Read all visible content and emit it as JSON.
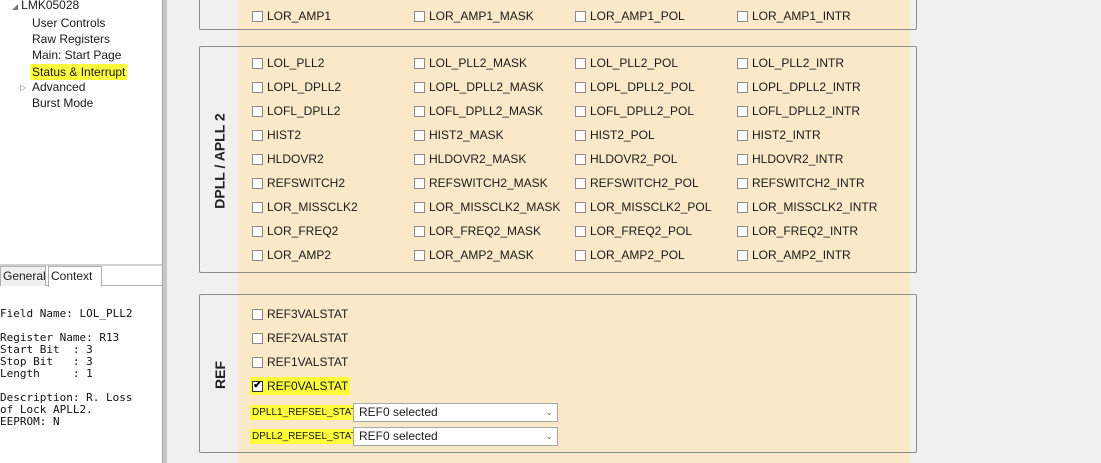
{
  "tree": {
    "root": "LMK05028",
    "items": [
      "User Controls",
      "Raw Registers",
      "Main: Start Page",
      "Status & Interrupt",
      "Advanced",
      "Burst Mode"
    ]
  },
  "tabs": [
    "General",
    "Context"
  ],
  "context_lines": [
    "Field Name: LOL_PLL2",
    "",
    "Register Name: R13",
    "Start Bit  : 3",
    "Stop Bit   : 3",
    "Length     : 1",
    "",
    "Description: R. Loss",
    "of Lock APLL2.",
    "EEPROM: N"
  ],
  "top_row": [
    "LOR_AMP1",
    "LOR_AMP1_MASK",
    "LOR_AMP1_POL",
    "LOR_AMP1_INTR"
  ],
  "dpll2": {
    "label": "DPLL / APLL 2",
    "rows": [
      [
        "LOL_PLL2",
        "LOL_PLL2_MASK",
        "LOL_PLL2_POL",
        "LOL_PLL2_INTR"
      ],
      [
        "LOPL_DPLL2",
        "LOPL_DPLL2_MASK",
        "LOPL_DPLL2_POL",
        "LOPL_DPLL2_INTR"
      ],
      [
        "LOFL_DPLL2",
        "LOFL_DPLL2_MASK",
        "LOFL_DPLL2_POL",
        "LOFL_DPLL2_INTR"
      ],
      [
        "HIST2",
        "HIST2_MASK",
        "HIST2_POL",
        "HIST2_INTR"
      ],
      [
        "HLDOVR2",
        "HLDOVR2_MASK",
        "HLDOVR2_POL",
        "HLDOVR2_INTR"
      ],
      [
        "REFSWITCH2",
        "REFSWITCH2_MASK",
        "REFSWITCH2_POL",
        "REFSWITCH2_INTR"
      ],
      [
        "LOR_MISSCLK2",
        "LOR_MISSCLK2_MASK",
        "LOR_MISSCLK2_POL",
        "LOR_MISSCLK2_INTR"
      ],
      [
        "LOR_FREQ2",
        "LOR_FREQ2_MASK",
        "LOR_FREQ2_POL",
        "LOR_FREQ2_INTR"
      ],
      [
        "LOR_AMP2",
        "LOR_AMP2_MASK",
        "LOR_AMP2_POL",
        "LOR_AMP2_INTR"
      ]
    ]
  },
  "ref": {
    "label": "REF",
    "items": [
      {
        "label": "REF3VALSTAT",
        "checked": false
      },
      {
        "label": "REF2VALSTAT",
        "checked": false
      },
      {
        "label": "REF1VALSTAT",
        "checked": false
      },
      {
        "label": "REF0VALSTAT",
        "checked": true
      }
    ],
    "selects": [
      {
        "label": "DPLL1_REFSEL_STAT",
        "value": "REF0 selected"
      },
      {
        "label": "DPLL2_REFSEL_STAT",
        "value": "REF0 selected"
      }
    ]
  },
  "colors": {
    "panel_band": "#fae9c8",
    "highlight": "#fdfd3c",
    "background": "#f0f0f0"
  }
}
